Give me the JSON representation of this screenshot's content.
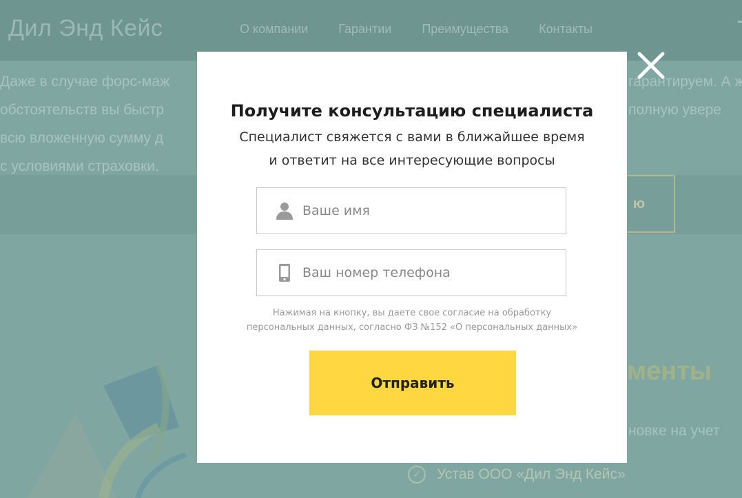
{
  "background": {
    "logo": "Дил Энд Кейс",
    "nav": [
      "О компании",
      "Гарантии",
      "Преимущества",
      "Контакты"
    ],
    "paragraph_left": [
      "Даже в случае форс-маж",
      "обстоятельств вы быстр",
      "всю вложенную сумму д",
      "с условиями страховки."
    ],
    "paragraph_right": [
      "гарантируем. А ж",
      "полную увере"
    ],
    "outline_button_fragment": "ю",
    "heading_fragment": "менты",
    "line_fragment": "новке на учет",
    "bottom_item": "Устав ООО «Дил Энд Кейс»"
  },
  "modal": {
    "title": "Получите консультацию специалиста",
    "subtitle_line1": "Специалист свяжется с вами в ближайшее время",
    "subtitle_line2": "и ответит на все интересующие вопросы",
    "name_placeholder": "Ваше имя",
    "phone_placeholder": "Ваш номер телефона",
    "consent_line1": "Нажимая на кнопку, вы даете свое согласие на обработку",
    "consent_line2": "персональных данных, согласно ФЗ №152 «О персональных данных»",
    "submit_label": "Отправить"
  },
  "colors": {
    "overlay": "#80a6a2",
    "accent": "#ffd740",
    "modal_bg": "#ffffff"
  },
  "icons": {
    "close": "close-icon",
    "user": "user-icon",
    "phone": "phone-icon",
    "check": "check-circle-icon"
  }
}
